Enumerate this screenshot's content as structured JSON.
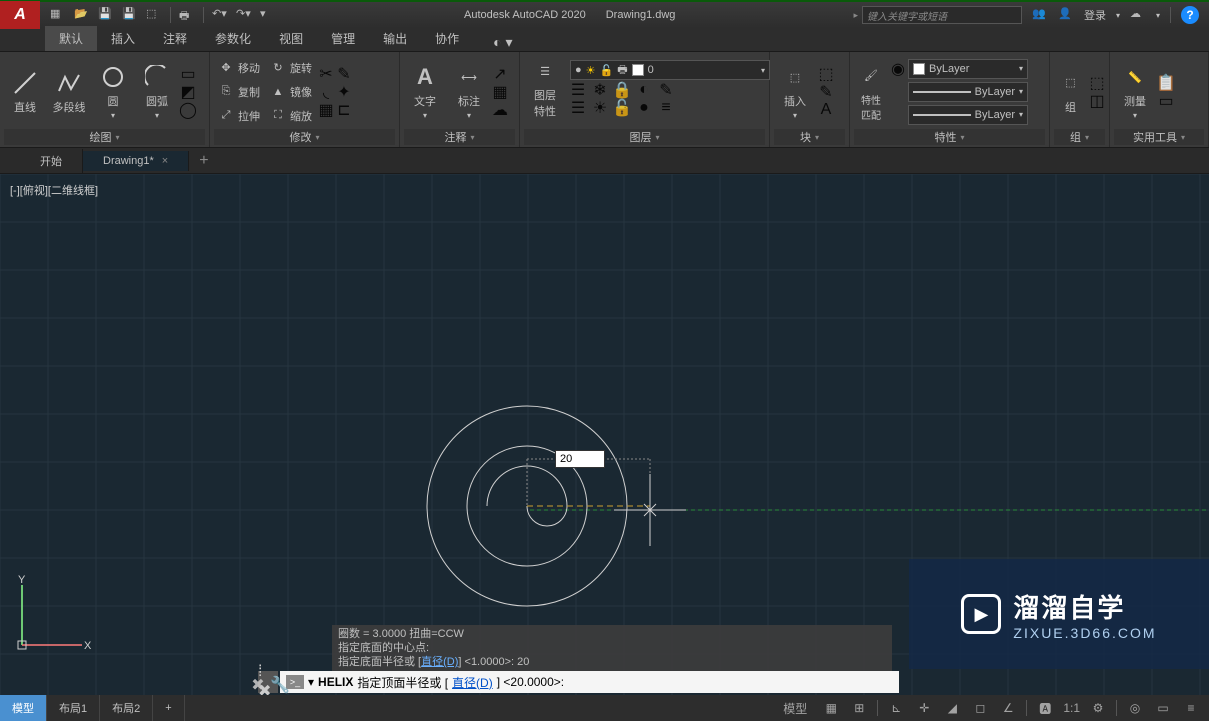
{
  "titlebar": {
    "app": "Autodesk AutoCAD 2020",
    "file": "Drawing1.dwg",
    "search_placeholder": "键入关键字或短语",
    "login": "登录"
  },
  "tabs": {
    "default": "默认",
    "insert": "插入",
    "annotate": "注释",
    "parametric": "参数化",
    "view": "视图",
    "manage": "管理",
    "output": "输出",
    "collaborate": "协作"
  },
  "panels": {
    "draw": {
      "label": "绘图",
      "line": "直线",
      "polyline": "多段线",
      "circle": "圆",
      "arc": "圆弧"
    },
    "modify": {
      "label": "修改",
      "move": "移动",
      "rotate": "旋转",
      "copy": "复制",
      "mirror": "镜像",
      "stretch": "拉伸",
      "scale": "缩放"
    },
    "annotation": {
      "label": "注释",
      "text": "文字",
      "dim": "标注"
    },
    "layers": {
      "label": "图层",
      "props": "图层\n特性",
      "current": "0"
    },
    "block": {
      "label": "块",
      "insert": "插入"
    },
    "properties": {
      "label": "特性",
      "match": "特性\n匹配",
      "bylayer": "ByLayer"
    },
    "group": {
      "label": "组",
      "btn": "组"
    },
    "utilities": {
      "label": "实用工具",
      "measure": "测量"
    }
  },
  "file_tabs": {
    "start": "开始",
    "drawing": "Drawing1*"
  },
  "canvas": {
    "view_label": "[-][俯视][二维线框]",
    "dyn_value": "20",
    "cmd_history": {
      "l1": "圈数 = 3.0000    扭曲=CCW",
      "l2": "指定底面的中心点:",
      "l3_a": "指定底面半径或 [",
      "l3_link": "直径(D)",
      "l3_b": "] <1.0000>:  20"
    },
    "cmd_line": {
      "cmd": "HELIX",
      "prompt_a": "指定顶面半径或 [",
      "link": "直径(D)",
      "prompt_b": "] <20.0000>:"
    }
  },
  "status": {
    "model": "模型",
    "layout1": "布局1",
    "layout2": "布局2",
    "model_btn": "模型",
    "scale": "1:1"
  },
  "watermark": {
    "cn": "溜溜自学",
    "url": "ZIXUE.3D66.COM"
  }
}
